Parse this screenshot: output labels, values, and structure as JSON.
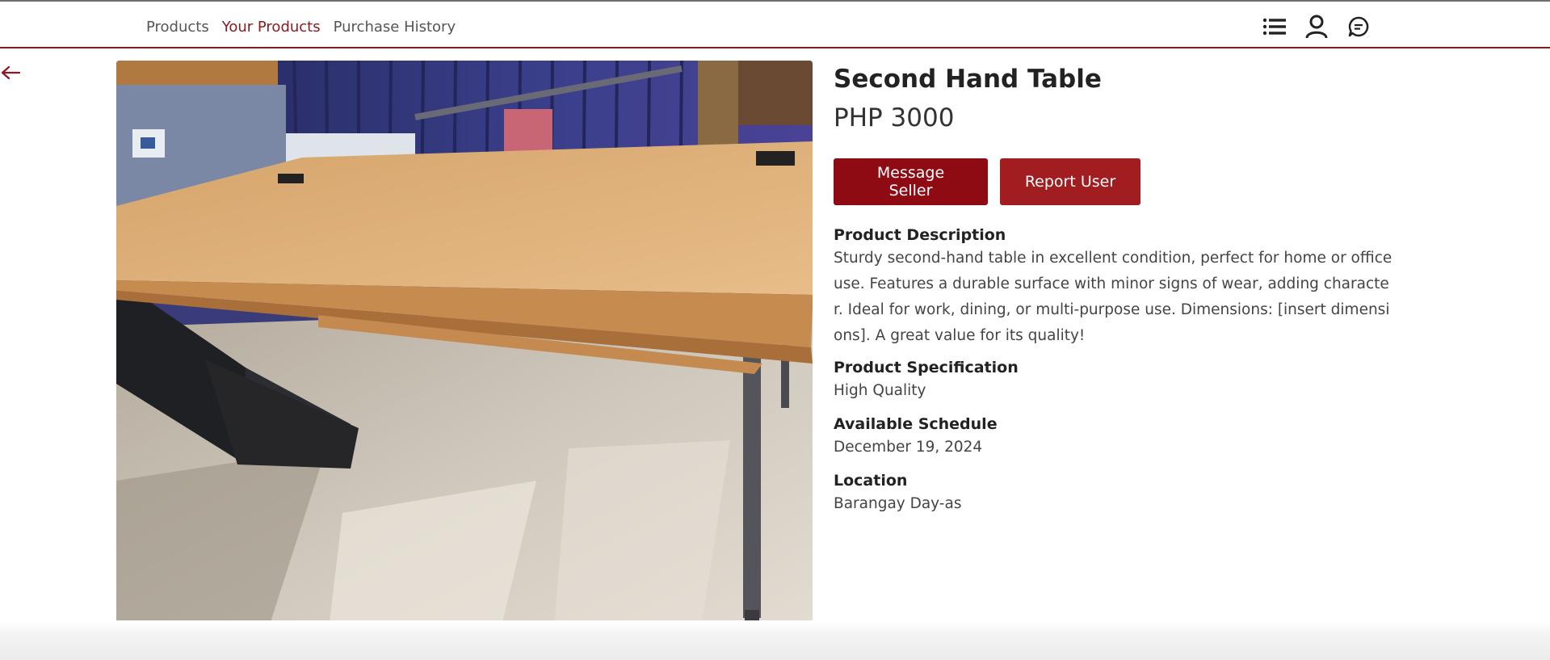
{
  "nav": {
    "links": [
      {
        "label": "Products"
      },
      {
        "label": "Your Products"
      },
      {
        "label": "Purchase History"
      }
    ],
    "icons": [
      "list-icon",
      "user-icon",
      "chat-icon"
    ]
  },
  "product": {
    "title": "Second Hand Table",
    "price": "PHP 3000",
    "actions": {
      "message_label": "Message Seller",
      "report_label": "Report User"
    },
    "description": {
      "label": "Product Description",
      "value": "Sturdy second-hand table in excellent condition, perfect for home or office use. Features a durable surface with minor signs of wear, adding character. Ideal for work, dining, or multi-purpose use. Dimensions: [insert dimensions]. A great value for its quality!"
    },
    "specification": {
      "label": "Product Specification",
      "value": "High Quality"
    },
    "schedule": {
      "label": "Available Schedule",
      "value": "December 19, 2024"
    },
    "location": {
      "label": "Location",
      "value": "Barangay Day-as"
    }
  },
  "colors": {
    "accent": "#8b1a22",
    "message_button": "#8e0b14",
    "report_button": "#a21d20"
  }
}
